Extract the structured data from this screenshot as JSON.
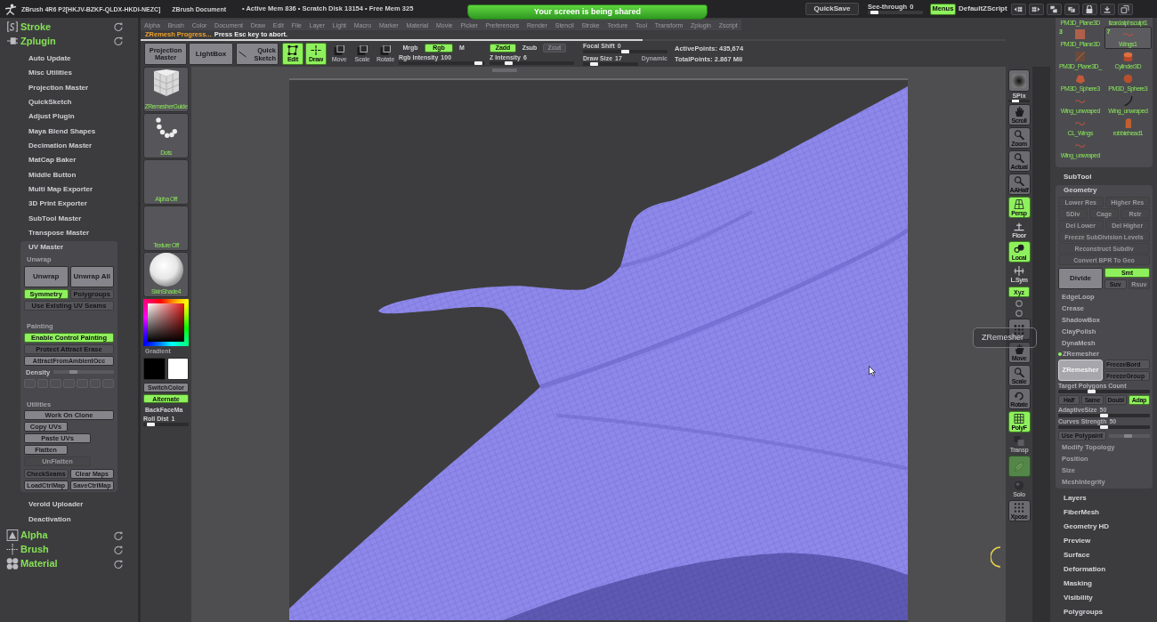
{
  "title_bar": {
    "app_title": "ZBrush 4R6 P2[HKJV-BZKF-QLDX-HKDI-NEZC]",
    "document": "ZBrush Document",
    "memory": "• Active Mem 836 • Scratch Disk 13154 • Free Mem 325",
    "quicksave": "QuickSave",
    "see_through": {
      "label": "See-through",
      "value": "0",
      "level": 0.05
    },
    "menus": {
      "label": "Menus",
      "on": true
    },
    "script": "DefaultZScript"
  },
  "share_banner": "Your screen is being shared",
  "menu_bar": [
    "Alpha",
    "Brush",
    "Color",
    "Document",
    "Draw",
    "Edit",
    "File",
    "Layer",
    "Light",
    "Macro",
    "Marker",
    "Material",
    "Movie",
    "Picker",
    "Preferences",
    "Render",
    "Stencil",
    "Stroke",
    "Texture",
    "Tool",
    "Transform",
    "Zplugin",
    "Zscript"
  ],
  "progress": {
    "title": "ZRemesh Progress...",
    "hint": "Press Esc key to abort.",
    "level": 0.58
  },
  "top_shelf": {
    "buttons": [
      "Projection Master",
      "LightBox",
      "Quick Sketch"
    ],
    "modes": [
      {
        "label": "Edit",
        "on": true
      },
      {
        "label": "Draw",
        "on": true
      },
      {
        "label": "Move",
        "on": false
      },
      {
        "label": "Scale",
        "on": false
      },
      {
        "label": "Rotate",
        "on": false
      }
    ],
    "color_modes": [
      {
        "label": "Mrgb",
        "on": false
      },
      {
        "label": "Rgb",
        "on": true
      },
      {
        "label": "M",
        "on": false
      }
    ],
    "rgb_intensity": {
      "label": "Rgb Intensity",
      "value": "100",
      "level": 0.97
    },
    "z_modes": [
      {
        "label": "Zadd",
        "on": true,
        "disabled": false
      },
      {
        "label": "Zsub",
        "on": false,
        "disabled": false
      },
      {
        "label": "Zcut",
        "on": false,
        "disabled": true
      }
    ],
    "z_intensity": {
      "label": "Z Intensity",
      "value": "6",
      "level": 0.2
    },
    "focal_shift": {
      "label": "Focal Shift",
      "value": "0",
      "level": 0.5
    },
    "draw_size": {
      "label": "Draw Size",
      "value": "17",
      "level": 0.15
    },
    "dynamic": "Dynamic",
    "active_points": "ActivePoints: 435,674",
    "total_points": "TotalPoints: 2.867 Mil"
  },
  "left_panel": {
    "top_palettes": [
      "Stroke",
      "Zplugin"
    ],
    "plugins": [
      "Auto Update",
      "Misc Utilities",
      "Projection Master",
      "QuickSketch",
      "Adjust Plugin",
      "Maya Blend Shapes",
      "Decimation Master",
      "MatCap Baker",
      "Middle Button",
      "Multi Map Exporter",
      "3D Print Exporter",
      "SubTool Master",
      "Transpose Master"
    ],
    "uv_master": {
      "title": "UV Master",
      "unwrap_header": "Unwrap",
      "unwrap_buttons": [
        "Unwrap",
        "Unwrap All"
      ],
      "options": [
        {
          "label": "Symmetry",
          "on": true
        },
        {
          "label": "Polygroups",
          "on": false
        }
      ],
      "use_seams": {
        "label": "Use Existing UV Seams",
        "on": false
      },
      "painting_header": "Painting",
      "control_painting": {
        "label": "Enable Control Painting",
        "on": true
      },
      "protect": {
        "label": "Protect Attract Erase",
        "on": false
      },
      "attract": "AttractFromAmbientOcc",
      "density": {
        "label": "Density",
        "level": 0.3,
        "disabled": true
      },
      "density_presets": [
        {
          "disabled": true
        },
        {
          "disabled": true
        },
        {
          "disabled": true
        },
        {
          "disabled": true
        },
        {
          "disabled": true
        },
        {
          "disabled": true
        },
        {
          "disabled": true
        }
      ],
      "utilities_header": "Utilities",
      "utilities": [
        {
          "label": "Work On Clone",
          "disabled": false
        },
        {
          "label": "Copy UVs",
          "disabled": false
        },
        {
          "label": "Paste UVs",
          "disabled": false
        },
        {
          "label": "Flatten",
          "disabled": false
        },
        {
          "label": "UnFlatten",
          "disabled": true
        }
      ],
      "maps": [
        {
          "label": "CheckSeams",
          "kind": "switch",
          "on": false
        },
        {
          "label": "Clear Maps",
          "kind": "button"
        },
        {
          "label": "LoadCtrlMap",
          "kind": "button"
        },
        {
          "label": "SaveCtrlMap",
          "kind": "button"
        }
      ]
    },
    "more_plugins": [
      "Verold Uploader",
      "Deactivation"
    ],
    "bottom_palettes": [
      "Alpha",
      "Brush",
      "Material"
    ]
  },
  "left_shelf": {
    "tiles": [
      "ZRemesherGuide",
      "Dots",
      "Alpha Off",
      "Texture Off",
      "SkinShade4"
    ],
    "gradient": "Gradient",
    "swatches": [
      {
        "color": "#000000"
      },
      {
        "color": "#ffffff"
      }
    ],
    "switch_color": "SwitchColor",
    "alternate": {
      "label": "Alternate",
      "on": true
    },
    "backface": {
      "label": "BackFaceMa",
      "on": false
    },
    "roll_dist": {
      "label": "Roll Dist",
      "value": "1",
      "level": 0.1
    }
  },
  "tooltip": "ZRemesher",
  "right_shelf": [
    {
      "kind": "slider",
      "label": "SPix",
      "level": 0.25
    },
    {
      "kind": "button",
      "label": "Scroll",
      "on": false,
      "disabled": false
    },
    {
      "kind": "button",
      "label": "Zoom",
      "on": false,
      "disabled": false
    },
    {
      "kind": "button",
      "label": "Actual",
      "on": false,
      "disabled": false
    },
    {
      "kind": "button",
      "label": "AAHalf",
      "on": false,
      "disabled": false
    },
    {
      "kind": "button",
      "label": "Persp",
      "on": true,
      "disabled": false
    },
    {
      "kind": "plain",
      "label": "Floor",
      "on": false,
      "disabled": false
    },
    {
      "kind": "button",
      "label": "Local",
      "on": true,
      "disabled": false
    },
    {
      "kind": "plain",
      "label": "L.Sym",
      "on": false,
      "disabled": false
    },
    {
      "kind": "small",
      "label": "Xyz",
      "on": true,
      "disabled": false
    },
    {
      "kind": "dot"
    },
    {
      "kind": "dot"
    },
    {
      "kind": "button",
      "on": false,
      "disabled": false
    },
    {
      "kind": "button",
      "label": "Move",
      "on": false,
      "disabled": false
    },
    {
      "kind": "button",
      "label": "Scale",
      "on": false,
      "disabled": false
    },
    {
      "kind": "button",
      "label": "Rotate",
      "on": false,
      "disabled": false
    },
    {
      "kind": "button",
      "label": "PolyF",
      "on": true,
      "disabled": false
    },
    {
      "kind": "plain",
      "label": "Transp",
      "on": false,
      "disabled": true
    },
    {
      "kind": "button",
      "on": true,
      "disabled": true
    },
    {
      "kind": "plain",
      "label": "Solo",
      "on": false,
      "disabled": true
    },
    {
      "kind": "button",
      "label": "Xpose",
      "on": false,
      "disabled": false
    }
  ],
  "right_panel": {
    "subtools": [
      {
        "kind": "cut",
        "label": "PM3D_Plane3D",
        "selected": false
      },
      {
        "kind": "cut",
        "label": "lizardalphsculpt1",
        "selected": false
      },
      {
        "kind": "thumb",
        "label": "PM3D_Plane3D",
        "badge": "3",
        "selected": false
      },
      {
        "kind": "thumb",
        "label": "Wings1",
        "badge": "7",
        "selected": true
      },
      {
        "kind": "thumb",
        "label": "PM3D_Plane3D_",
        "selected": false
      },
      {
        "kind": "thumb",
        "label": "Cylinder3D",
        "selected": false
      },
      {
        "kind": "thumb",
        "label": "PM3D_Sphere3",
        "selected": false
      },
      {
        "kind": "thumb",
        "label": "PM3D_Sphere3",
        "selected": false
      },
      {
        "kind": "thumb",
        "label": "Wing_unwraped",
        "selected": false
      },
      {
        "kind": "thumb",
        "label": "Wing_unwraped",
        "selected": false
      },
      {
        "kind": "thumb",
        "label": "CL_Wings",
        "selected": false
      },
      {
        "kind": "thumb",
        "label": "robbiehead1",
        "selected": false
      },
      {
        "kind": "thumb",
        "label": "Wing_unwraped",
        "selected": false
      }
    ],
    "subtool_header": "SubTool",
    "geometry": {
      "title": "Geometry",
      "subdiv_rows": [
        [
          {
            "label": "Lower Res",
            "disabled": true
          },
          {
            "label": "Higher Res",
            "disabled": true
          }
        ],
        [
          {
            "label": "SDiv",
            "disabled": true
          },
          {
            "label": "Cage",
            "disabled": true
          },
          {
            "label": "Rstr",
            "disabled": true
          }
        ],
        [
          {
            "label": "Del Lower",
            "disabled": true
          },
          {
            "label": "Del Higher",
            "disabled": true
          }
        ],
        [
          {
            "label": "Freeze SubDivision Levels",
            "disabled": true
          }
        ],
        [
          {
            "label": "Reconstruct Subdiv",
            "disabled": true
          }
        ],
        [
          {
            "label": "Convert BPR To Geo",
            "disabled": true
          }
        ]
      ],
      "divide": "Divide",
      "divide_options": [
        {
          "label": "Smt",
          "on": true,
          "disabled": false
        },
        {
          "label": "Suv",
          "on": false,
          "disabled": false
        },
        {
          "label": "Rsuv",
          "on": false,
          "disabled": true
        }
      ],
      "sections": [
        "EdgeLoop",
        "Crease",
        "ShadowBox",
        "ClayPolish",
        "DynaMesh"
      ],
      "zremesher": {
        "title": "ZRemesher",
        "expanded": true,
        "button": {
          "label": "ZRemesher",
          "pressed": true
        },
        "freeze": [
          {
            "label": "FreezeBord",
            "on": false
          },
          {
            "label": "FreezeGroup",
            "on": false
          }
        ],
        "target": {
          "label": "Target Polygons Count",
          "level": 0.35
        },
        "modes": [
          {
            "label": "Half",
            "on": false
          },
          {
            "label": "Same",
            "on": false
          },
          {
            "label": "Doubl",
            "on": false
          },
          {
            "label": "Adap",
            "on": true
          }
        ],
        "adaptive_size": {
          "label": "AdaptiveSize",
          "value": "50",
          "level": 0.5
        },
        "curves_strength": {
          "label": "Curves Strength",
          "value": "50",
          "level": 0.5
        },
        "use_polypaint": {
          "label": "Use Polypaint",
          "on": false,
          "level": 0.45
        }
      },
      "more_sections": [
        "Modify Topology",
        "Position",
        "Size",
        "MeshIntegrity"
      ]
    },
    "palettes": [
      "Layers",
      "FiberMesh",
      "Geometry HD",
      "Preview",
      "Surface",
      "Deformation",
      "Masking",
      "Visibility",
      "Polygroups"
    ]
  }
}
